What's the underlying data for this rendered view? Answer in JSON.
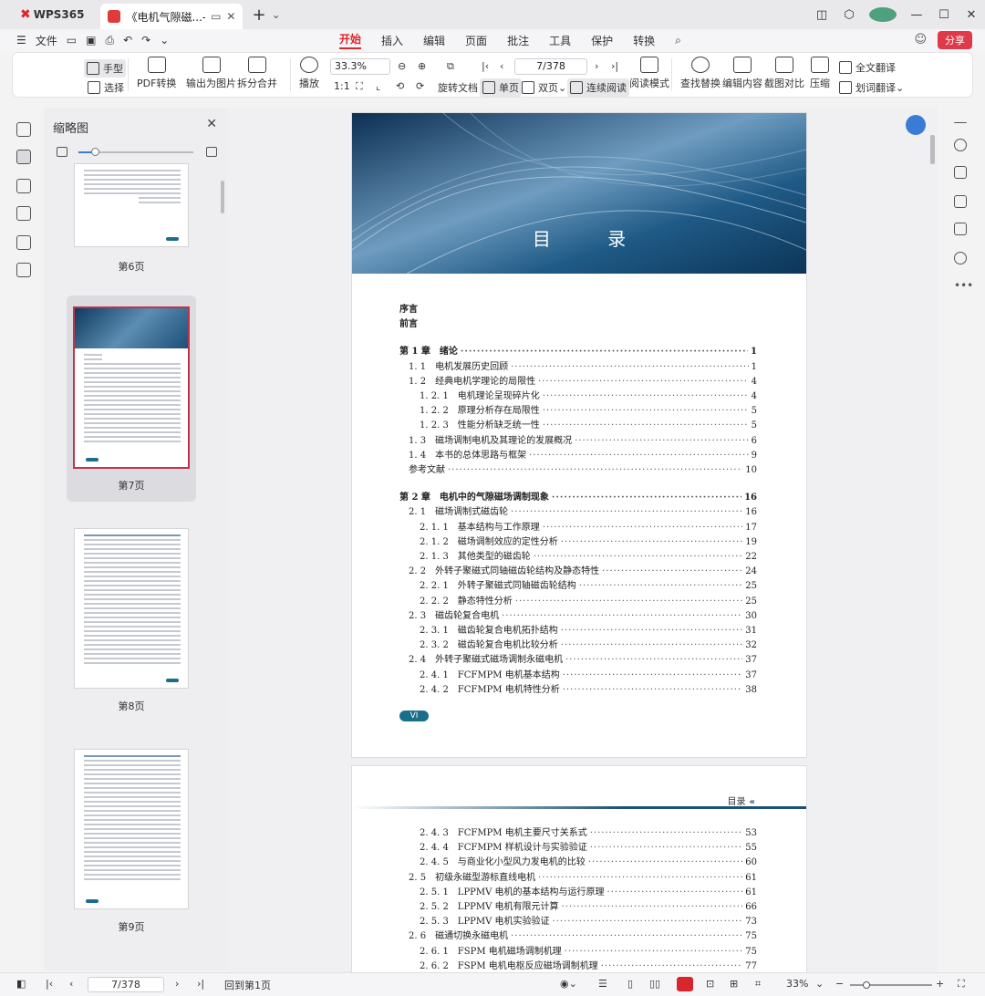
{
  "titlebar": {
    "app_tab": "WPS365",
    "doc_tab_title": "《电机气隙磁...-7.pdf"
  },
  "menubar": {
    "file_label": "文件",
    "tabs": [
      "开始",
      "插入",
      "编辑",
      "页面",
      "批注",
      "工具",
      "保护",
      "转换"
    ],
    "active_tab": "开始",
    "share_label": "分享"
  },
  "ribbon": {
    "hand": "手型",
    "select": "选择",
    "pdf_convert": "PDF转换",
    "export_image": "输出为图片",
    "split_merge": "拆分合并",
    "play": "播放",
    "zoom": "33.3%",
    "page": "7/378",
    "rotate_doc": "旋转文档",
    "single_page": "单页",
    "double_page": "双页",
    "continuous": "连续阅读",
    "read_mode": "阅读模式",
    "find_replace": "查找替换",
    "edit_content": "编辑内容",
    "screenshot_compare": "截图对比",
    "compress": "压缩",
    "full_translate": "全文翻译",
    "word_translate": "划词翻译"
  },
  "thumbnails": {
    "title": "缩略图",
    "pages": [
      {
        "label": "第6页"
      },
      {
        "label": "第7页"
      },
      {
        "label": "第8页"
      },
      {
        "label": "第9页"
      }
    ],
    "slider_level": 0.14
  },
  "page7": {
    "banner_title": "目 录",
    "badge": "VI",
    "toc": [
      {
        "label": "序言",
        "page": "",
        "level": 0,
        "bold": true
      },
      {
        "label": "前言",
        "page": "",
        "level": 0,
        "bold": true
      },
      {
        "label": "第 1 章　绪论",
        "page": "1",
        "level": 0,
        "bold": true
      },
      {
        "label": "1. 1　电机发展历史回顾",
        "page": "1",
        "level": 1
      },
      {
        "label": "1. 2　经典电机学理论的局限性",
        "page": "4",
        "level": 1
      },
      {
        "label": "1. 2. 1　电机理论呈现碎片化",
        "page": "4",
        "level": 2
      },
      {
        "label": "1. 2. 2　原理分析存在局限性",
        "page": "5",
        "level": 2
      },
      {
        "label": "1. 2. 3　性能分析缺乏统一性",
        "page": "5",
        "level": 2
      },
      {
        "label": "1. 3　磁场调制电机及其理论的发展概况",
        "page": "6",
        "level": 1
      },
      {
        "label": "1. 4　本书的总体思路与框架",
        "page": "9",
        "level": 1
      },
      {
        "label": "参考文献",
        "page": "10",
        "level": 1
      },
      {
        "label": "第 2 章　电机中的气隙磁场调制现象",
        "page": "16",
        "level": 0,
        "bold": true
      },
      {
        "label": "2. 1　磁场调制式磁齿轮",
        "page": "16",
        "level": 1
      },
      {
        "label": "2. 1. 1　基本结构与工作原理",
        "page": "17",
        "level": 2
      },
      {
        "label": "2. 1. 2　磁场调制效应的定性分析",
        "page": "19",
        "level": 2
      },
      {
        "label": "2. 1. 3　其他类型的磁齿轮",
        "page": "22",
        "level": 2
      },
      {
        "label": "2. 2　外转子聚磁式同轴磁齿轮结构及静态特性",
        "page": "24",
        "level": 1
      },
      {
        "label": "2. 2. 1　外转子聚磁式同轴磁齿轮结构",
        "page": "25",
        "level": 2
      },
      {
        "label": "2. 2. 2　静态特性分析",
        "page": "25",
        "level": 2
      },
      {
        "label": "2. 3　磁齿轮复合电机",
        "page": "30",
        "level": 1
      },
      {
        "label": "2. 3. 1　磁齿轮复合电机拓扑结构",
        "page": "31",
        "level": 2
      },
      {
        "label": "2. 3. 2　磁齿轮复合电机比较分析",
        "page": "32",
        "level": 2
      },
      {
        "label": "2. 4　外转子聚磁式磁场调制永磁电机",
        "page": "37",
        "level": 1
      },
      {
        "label": "2. 4. 1　FCFMPM 电机基本结构",
        "page": "37",
        "level": 2
      },
      {
        "label": "2. 4. 2　FCFMPM 电机特性分析",
        "page": "38",
        "level": 2
      }
    ]
  },
  "page8": {
    "header_mark": "目录",
    "toc": [
      {
        "label": "2. 4. 3　FCFMPM 电机主要尺寸关系式",
        "page": "53",
        "level": 2
      },
      {
        "label": "2. 4. 4　FCFMPM 样机设计与实验验证",
        "page": "55",
        "level": 2
      },
      {
        "label": "2. 4. 5　与商业化小型风力发电机的比较",
        "page": "60",
        "level": 2
      },
      {
        "label": "2. 5　初级永磁型游标直线电机",
        "page": "61",
        "level": 1
      },
      {
        "label": "2. 5. 1　LPPMV 电机的基本结构与运行原理",
        "page": "61",
        "level": 2
      },
      {
        "label": "2. 5. 2　LPPMV 电机有限元计算",
        "page": "66",
        "level": 2
      },
      {
        "label": "2. 5. 3　LPPMV 电机实验验证",
        "page": "73",
        "level": 2
      },
      {
        "label": "2. 6　磁通切换永磁电机",
        "page": "75",
        "level": 1
      },
      {
        "label": "2. 6. 1　FSPM 电机磁场调制机理",
        "page": "75",
        "level": 2
      },
      {
        "label": "2. 6. 2　FSPM 电机电枢反应磁场调制机理",
        "page": "77",
        "level": 2
      }
    ]
  },
  "statusbar": {
    "page": "7/378",
    "back_to_first": "回到第1页",
    "zoom": "33%"
  }
}
